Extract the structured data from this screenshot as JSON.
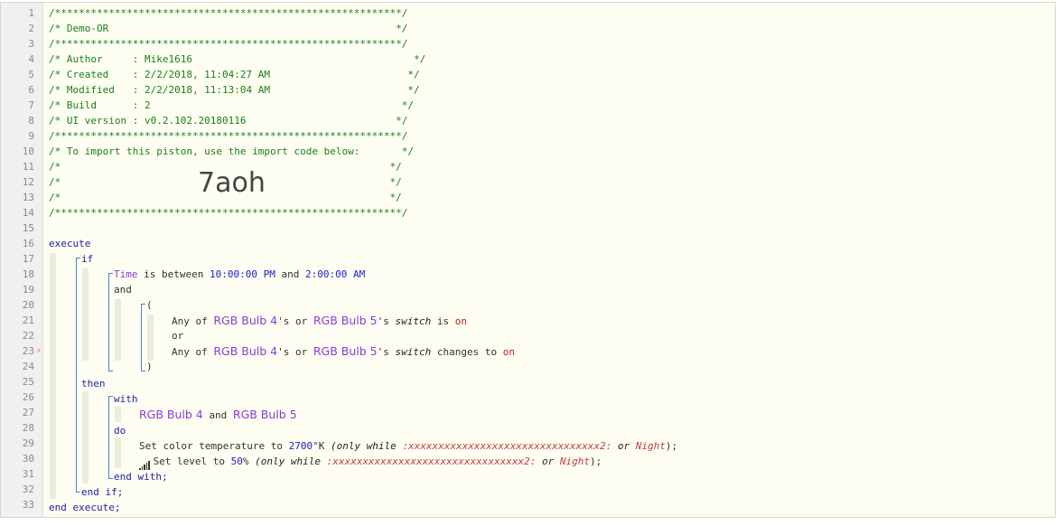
{
  "line_numbers": [
    "1",
    "2",
    "3",
    "4",
    "5",
    "6",
    "7",
    "8",
    "9",
    "10",
    "11",
    "12",
    "13",
    "14",
    "15",
    "16",
    "17",
    "18",
    "19",
    "20",
    "21",
    "22",
    "23",
    "24",
    "25",
    "26",
    "27",
    "28",
    "29",
    "30",
    "31",
    "32",
    "33"
  ],
  "header": {
    "border": "/**********************************************************/",
    "title": "/* Demo-OR                                                */",
    "author": "/* Author     : Mike1616                                     */",
    "created": "/* Created    : 2/2/2018, 11:04:27 AM                       */",
    "modified": "/* Modified   : 2/2/2018, 11:13:04 AM                       */",
    "build": "/* Build      : 2                                          */",
    "ui_version": "/* UI version : v0.2.102.20180116                         */",
    "import_note": "/* To import this piston, use the import code below:       */",
    "empty_comment": "/*                                                       */",
    "import_code": "7aoh"
  },
  "code": {
    "execute": "execute",
    "if": "if",
    "time_var": "Time",
    "is_between": " is between ",
    "time_start": "10:00:00 PM",
    "and_word": " and ",
    "time_end": "2:00:00 AM",
    "and": "and",
    "open_paren": "(",
    "any_of": "Any of ",
    "device_a": "RGB Bulb 4",
    "s_or": "'s or ",
    "device_b": "RGB Bulb 5",
    "s_switch": "'s ",
    "attr_switch": "switch",
    "is_word": " is ",
    "on_value": "on",
    "or": "or",
    "changes_to": " changes to ",
    "close_paren": ")",
    "then": "then",
    "with": "with",
    "and_devices": " and ",
    "do": "do",
    "set_color": "Set color temperature to ",
    "color_value": "2700",
    "color_unit": "°K ",
    "only_while_open": "(only while ",
    "condition_var": ":xxxxxxxxxxxxxxxxxxxxxxxxxxxxxxxx2:",
    "or_word": " or ",
    "condition_value": "Night",
    "only_while_close": ");",
    "set_level": "Set level to ",
    "level_value": "50",
    "level_unit": "% ",
    "end_with": "end with;",
    "end_if": "end if;",
    "end_execute": "end execute;"
  }
}
